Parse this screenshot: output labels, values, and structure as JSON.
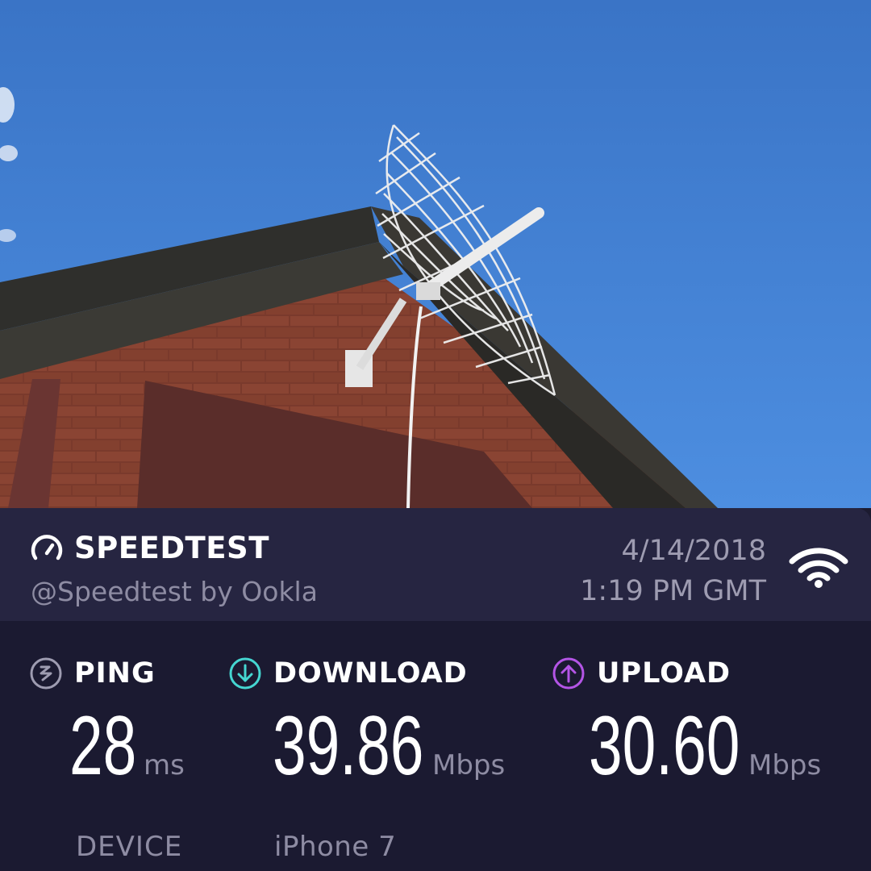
{
  "photo": {
    "description_icon": "grid-antenna-on-house-photo",
    "sky_color": "#3b78cc"
  },
  "speedtest": {
    "brand": "SPEEDTEST",
    "handle": "@Speedtest by Ookla",
    "date": "4/14/2018",
    "time": "1:19 PM GMT",
    "connection_icon": "wifi-icon"
  },
  "metrics": {
    "ping": {
      "label": "PING",
      "value": "28",
      "unit": "ms",
      "icon": "ping-icon",
      "color": "#9e9cb1"
    },
    "download": {
      "label": "DOWNLOAD",
      "value": "39.86",
      "unit": "Mbps",
      "icon": "download-arrow-icon",
      "color": "#45d6d1"
    },
    "upload": {
      "label": "UPLOAD",
      "value": "30.60",
      "unit": "Mbps",
      "icon": "upload-arrow-icon",
      "color": "#b455e6"
    }
  },
  "device": {
    "label": "DEVICE",
    "value": "iPhone 7"
  }
}
